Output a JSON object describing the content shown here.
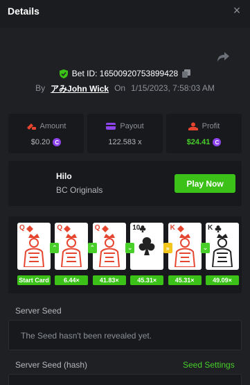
{
  "header": {
    "title": "Details",
    "close_glyph": "×"
  },
  "bet": {
    "id_label": "Bet ID: 16500920753899428",
    "by_label": "By",
    "user": "アみJohn Wick",
    "on_label": "On",
    "datetime": "1/15/2023, 7:58:03 AM"
  },
  "stats": {
    "amount": {
      "label": "Amount",
      "value": "$0.20"
    },
    "payout": {
      "label": "Payout",
      "value": "122.583 x"
    },
    "profit": {
      "label": "Profit",
      "value": "$24.41"
    }
  },
  "game": {
    "name": "Hilo",
    "provider": "BC Originals",
    "play_label": "Play Now"
  },
  "cards": [
    {
      "rank": "Q",
      "suit": "diamond",
      "color": "red",
      "multiplier": "Start Card"
    },
    {
      "rank": "Q",
      "suit": "diamond",
      "color": "red",
      "multiplier": "6.44×",
      "action": "up"
    },
    {
      "rank": "Q",
      "suit": "diamond",
      "color": "red",
      "multiplier": "41.83×",
      "action": "up"
    },
    {
      "rank": "10",
      "suit": "club",
      "color": "black",
      "multiplier": "45.31×",
      "action": "down"
    },
    {
      "rank": "K",
      "suit": "diamond",
      "color": "red",
      "multiplier": "45.31×",
      "action": "skip"
    },
    {
      "rank": "K",
      "suit": "club",
      "color": "black",
      "multiplier": "49.09×",
      "action": "down"
    }
  ],
  "server_seed": {
    "label": "Server Seed",
    "placeholder": "The Seed hasn't been revealed yet."
  },
  "server_seed_hash": {
    "label": "Server Seed (hash)",
    "settings_label": "Seed Settings"
  },
  "colors": {
    "accent": "#3bc117",
    "coin": "#8e44ec",
    "card_red": "#e5452f"
  },
  "icons": {
    "share": "share-icon",
    "verified": "shield-check-icon",
    "copy": "copy-icon",
    "amount": "bet-icon",
    "payout": "payout-icon",
    "profit": "profit-icon"
  }
}
